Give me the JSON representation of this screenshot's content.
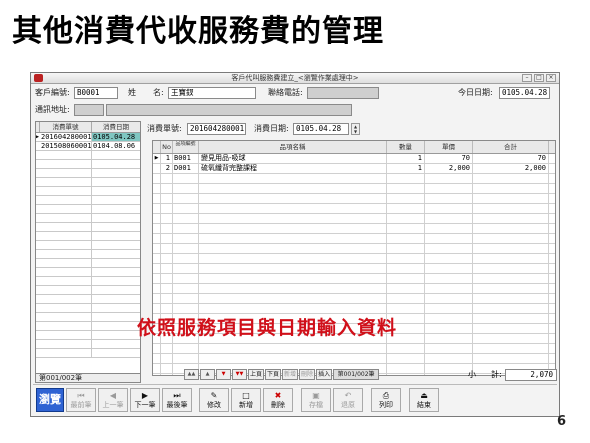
{
  "slide": {
    "title": "其他消費代收服務費的管理",
    "page_number": "6"
  },
  "window": {
    "title": "客戶代叫服務費建立_<瀏覽作業處理中>"
  },
  "header": {
    "customer_no_label": "客戶編號:",
    "customer_no": "B0001",
    "surname_label": "姓",
    "name_label": "名:",
    "name_value": "王寶釵",
    "phone_label": "聯絡電話:",
    "phone_value": "",
    "today_label": "今日日期:",
    "today_value": "0105.04.28",
    "address_label": "通訊地址:",
    "address_value": ""
  },
  "left_list": {
    "headers": [
      "消費單號",
      "消費日期"
    ],
    "rows": [
      {
        "no": "201604280001",
        "date": "0105.04.28"
      },
      {
        "no": "201508060001",
        "date": "0104.08.06"
      }
    ],
    "status": "第001/002筆"
  },
  "detail": {
    "order_label": "消費單號:",
    "order_value": "201604280001",
    "date_label": "消費日期:",
    "date_value": "0105.04.28",
    "headers": {
      "no": "No",
      "code": "品項編號",
      "name": "品項名稱",
      "qty": "數量",
      "price": "單價",
      "total": "合計"
    },
    "items": [
      {
        "no": "1",
        "code": "B001",
        "name": "變見用品-吸球",
        "qty": "1",
        "price": "70",
        "total": "70"
      },
      {
        "no": "2",
        "code": "D001",
        "name": "硫氧纖背完整課程",
        "qty": "1",
        "price": "2,000",
        "total": "2,000"
      }
    ]
  },
  "nav": {
    "prev_page": "上頁",
    "next_page": "下頁",
    "new": "新增",
    "delete": "刪除",
    "insert": "插入",
    "record": "第001/002筆"
  },
  "totals": {
    "label_small": "小",
    "label_calc": "計:",
    "value": "2,070"
  },
  "overlay_text": "依照服務項目與日期輸入資料",
  "toolbar": {
    "browse": "瀏覽",
    "first": "最前筆",
    "prev": "上一筆",
    "next": "下一筆",
    "last": "最後筆",
    "edit": "修改",
    "new": "新增",
    "delete": "刪除",
    "save": "存檔",
    "back": "退原",
    "print": "列印",
    "exit": "結束"
  }
}
